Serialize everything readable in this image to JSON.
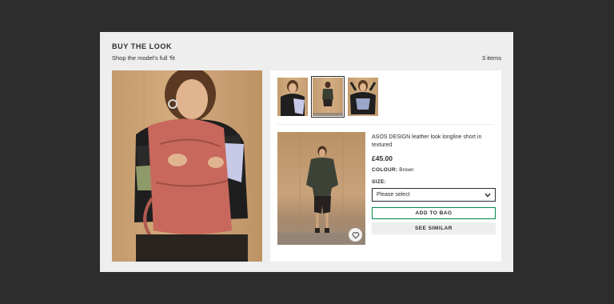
{
  "header": {
    "title": "BUY THE LOOK",
    "subtitle": "Shop the model's full 'fit",
    "item_count": "3 items"
  },
  "hero_image": {
    "description_icon": "model-photo"
  },
  "thumbnails": [
    {
      "name": "thumb-jumper",
      "selected": false
    },
    {
      "name": "thumb-shorts",
      "selected": true
    },
    {
      "name": "thumb-bag",
      "selected": false
    }
  ],
  "product": {
    "name": "ASOS DESIGN leather look longline short in textured",
    "price": "£45.00",
    "colour_label": "COLOUR:",
    "colour_value": "Brown",
    "size_label": "SIZE:",
    "size_placeholder": "Please select",
    "add_to_bag": "ADD TO BAG",
    "see_similar": "SEE SIMILAR"
  },
  "colors": {
    "accent_green": "#018849",
    "text": "#2d2d2d",
    "backdrop": "#2d2d2d"
  }
}
